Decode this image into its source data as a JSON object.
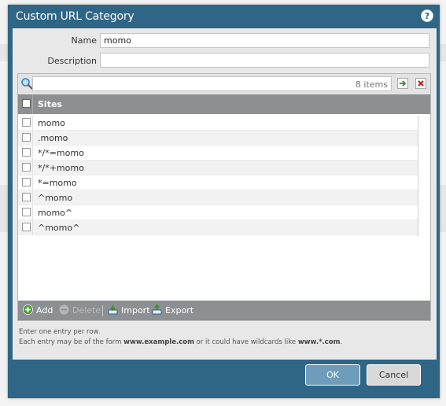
{
  "dialog": {
    "title": "Custom URL Category",
    "help_icon": "question-circle-icon"
  },
  "form": {
    "name_label": "Name",
    "name_value": "momo",
    "description_label": "Description",
    "description_value": ""
  },
  "grid": {
    "item_count": "8 items",
    "column_header": "Sites",
    "rows": [
      "momo",
      ".momo",
      "*/*=momo",
      "*/*+momo",
      "*=momo",
      "^momo",
      "momo^",
      "^momo^"
    ]
  },
  "toolbar": {
    "add_label": "Add",
    "delete_label": "Delete",
    "import_label": "Import",
    "export_label": "Export"
  },
  "hint": {
    "line1": "Enter one entry per row.",
    "line2_pre": "Each entry may be of the form",
    "line2_example": "www.example.com",
    "line2_mid": "or it could have wildcards like",
    "line2_wildcard": "www.*.com",
    "line2_end": "."
  },
  "buttons": {
    "ok": "OK",
    "cancel": "Cancel"
  },
  "colors": {
    "titlebar": "#2f6585",
    "header": "#8c9093",
    "ok_button": "#6f9cba"
  }
}
